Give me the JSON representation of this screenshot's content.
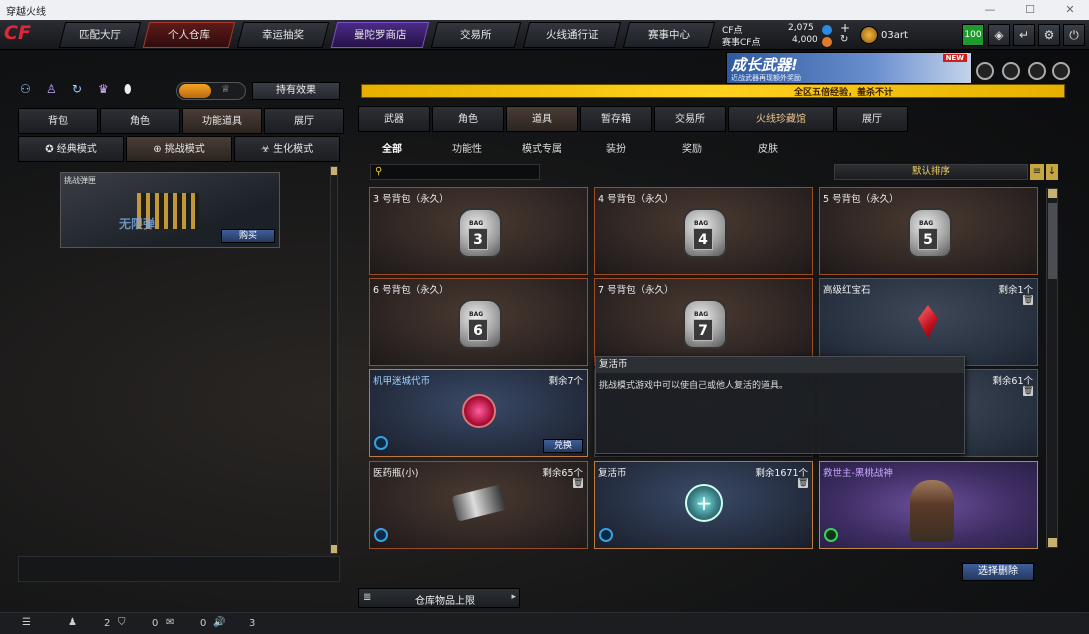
{
  "window": {
    "title": "穿越火线"
  },
  "nav": {
    "tabs": [
      "匹配大厅",
      "个人仓库",
      "幸运抽奖",
      "曼陀罗商店",
      "交易所",
      "火线通行证",
      "赛事中心"
    ],
    "active": "个人仓库"
  },
  "currency": {
    "cf_label": "CF点",
    "cf_value": "2,075",
    "match_label": "赛事CF点",
    "match_value": "4,000"
  },
  "user": {
    "name": "03art",
    "level": "100"
  },
  "banner": {
    "title": "成长武器!",
    "subtitle": "近战武器再现额外奖励",
    "badge": "NEW",
    "ticker": "全区五倍经验，羞杀不计"
  },
  "left": {
    "toggle_label": "持有效果",
    "tabs": [
      "背包",
      "角色",
      "功能道具",
      "展厅"
    ],
    "active_tab": "功能道具",
    "modes": [
      "经典模式",
      "挑战模式",
      "生化模式"
    ],
    "active_mode": "挑战模式",
    "card": {
      "title": "挑战弹匣",
      "watermark": "无限弹",
      "buy_label": "购买"
    }
  },
  "right": {
    "tabs": [
      "武器",
      "角色",
      "道具",
      "暂存箱",
      "交易所",
      "火线珍藏馆",
      "展厅"
    ],
    "active_tab": "道具",
    "subtabs": [
      "全部",
      "功能性",
      "模式专属",
      "装扮",
      "奖励",
      "皮肤"
    ],
    "active_subtab": "全部",
    "sort_label": "默认排序",
    "items": [
      {
        "name": "3 号背包（永久）",
        "num": "3"
      },
      {
        "name": "4 号背包（永久）",
        "num": "4"
      },
      {
        "name": "5 号背包（永久）",
        "num": "5"
      },
      {
        "name": "6 号背包（永久）",
        "num": "6"
      },
      {
        "name": "7 号背包（永久）",
        "num": "7"
      },
      {
        "name": "高级红宝石",
        "remain": "剩余1个"
      },
      {
        "name": "机甲迷城代币",
        "remain": "剩余7个",
        "action": "兑换"
      },
      {
        "name": "",
        "remain": "剩余61个"
      },
      {
        "name": "医药瓶(小)",
        "remain": "剩余65个"
      },
      {
        "name": "复活币",
        "remain": "剩余1671个"
      },
      {
        "name": "救世主-黑桃战神"
      }
    ],
    "tooltip": {
      "title": "复活币",
      "desc": "挑战模式游戏中可以使自己或他人复活的道具。"
    },
    "batch_delete": "选择删除",
    "capacity_label": "仓库物品上限"
  },
  "status": {
    "count1": "2",
    "count2": "0",
    "count3": "0",
    "count4": "3"
  },
  "colors": {
    "accent": "#c0602a",
    "banner_yellow": "#f2c200"
  }
}
